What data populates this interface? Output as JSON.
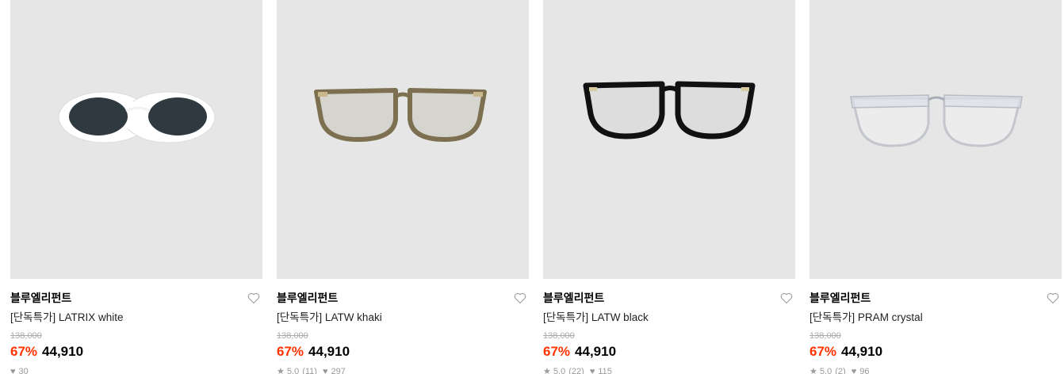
{
  "products": [
    {
      "brand": "블루엘리펀트",
      "name": "[단독특가] LATRIX white",
      "original_price": "138,000",
      "discount": "67%",
      "price": "44,910",
      "rating": "",
      "review_count": "",
      "like_icon": "heart-outline-icon",
      "likes": "30",
      "frame_color": "#ffffff",
      "lens_color": "#2e3a40"
    },
    {
      "brand": "블루엘리펀트",
      "name": "[단독특가] LATW khaki",
      "original_price": "138,000",
      "discount": "67%",
      "price": "44,910",
      "rating": "★ 5.0",
      "review_count": "(11)",
      "like_icon": "heart-outline-icon",
      "likes": "297",
      "frame_color": "#7d7050",
      "lens_color": "none"
    },
    {
      "brand": "블루엘리펀트",
      "name": "[단독특가] LATW black",
      "original_price": "138,000",
      "discount": "67%",
      "price": "44,910",
      "rating": "★ 5.0",
      "review_count": "(22)",
      "like_icon": "heart-outline-icon",
      "likes": "115",
      "frame_color": "#111111",
      "lens_color": "none"
    },
    {
      "brand": "블루엘리펀트",
      "name": "[단독특가] PRAM crystal",
      "original_price": "138,000",
      "discount": "67%",
      "price": "44,910",
      "rating": "★ 5.0",
      "review_count": "(2)",
      "like_icon": "heart-outline-icon",
      "likes": "96",
      "frame_color": "#c9ccd2",
      "lens_color": "none"
    }
  ],
  "colors": {
    "thumb_bg": "#e6e6e6",
    "discount": "#ff3300",
    "strike": "#aaaaaa"
  }
}
